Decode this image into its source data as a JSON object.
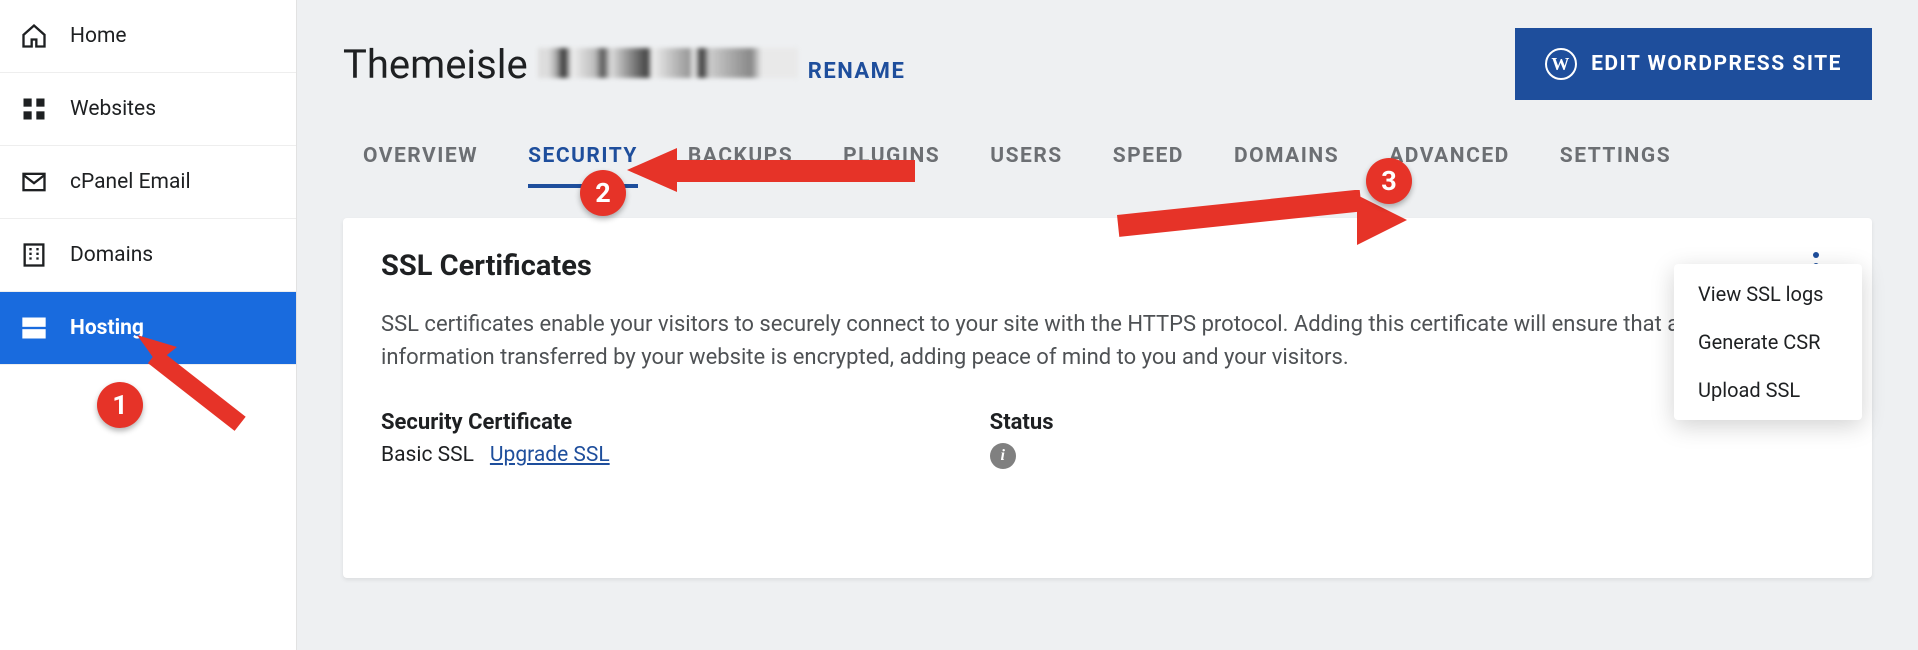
{
  "sidebar": {
    "items": [
      {
        "id": "home",
        "label": "Home"
      },
      {
        "id": "websites",
        "label": "Websites"
      },
      {
        "id": "cpanel-email",
        "label": "cPanel Email"
      },
      {
        "id": "domains",
        "label": "Domains"
      },
      {
        "id": "hosting",
        "label": "Hosting"
      }
    ],
    "active": "hosting"
  },
  "header": {
    "site_name": "Themeisle",
    "rename": "RENAME",
    "edit_button": "EDIT WORDPRESS SITE"
  },
  "tabs": {
    "items": [
      "OVERVIEW",
      "SECURITY",
      "BACKUPS",
      "PLUGINS",
      "USERS",
      "SPEED",
      "DOMAINS",
      "ADVANCED",
      "SETTINGS"
    ],
    "active": "SECURITY"
  },
  "ssl_card": {
    "title": "SSL Certificates",
    "description": "SSL certificates enable your visitors to securely connect to your site with the HTTPS protocol. Adding this certificate will ensure that any information transferred by your website is encrypted, adding peace of mind to you and your visitors.",
    "col1_title": "Security Certificate",
    "col1_value": "Basic SSL",
    "upgrade_link": "Upgrade SSL",
    "col2_title": "Status"
  },
  "dropdown": {
    "items": [
      "View SSL logs",
      "Generate CSR",
      "Upload SSL"
    ]
  },
  "annotations": {
    "badge1": "1",
    "badge2": "2",
    "badge3": "3"
  }
}
